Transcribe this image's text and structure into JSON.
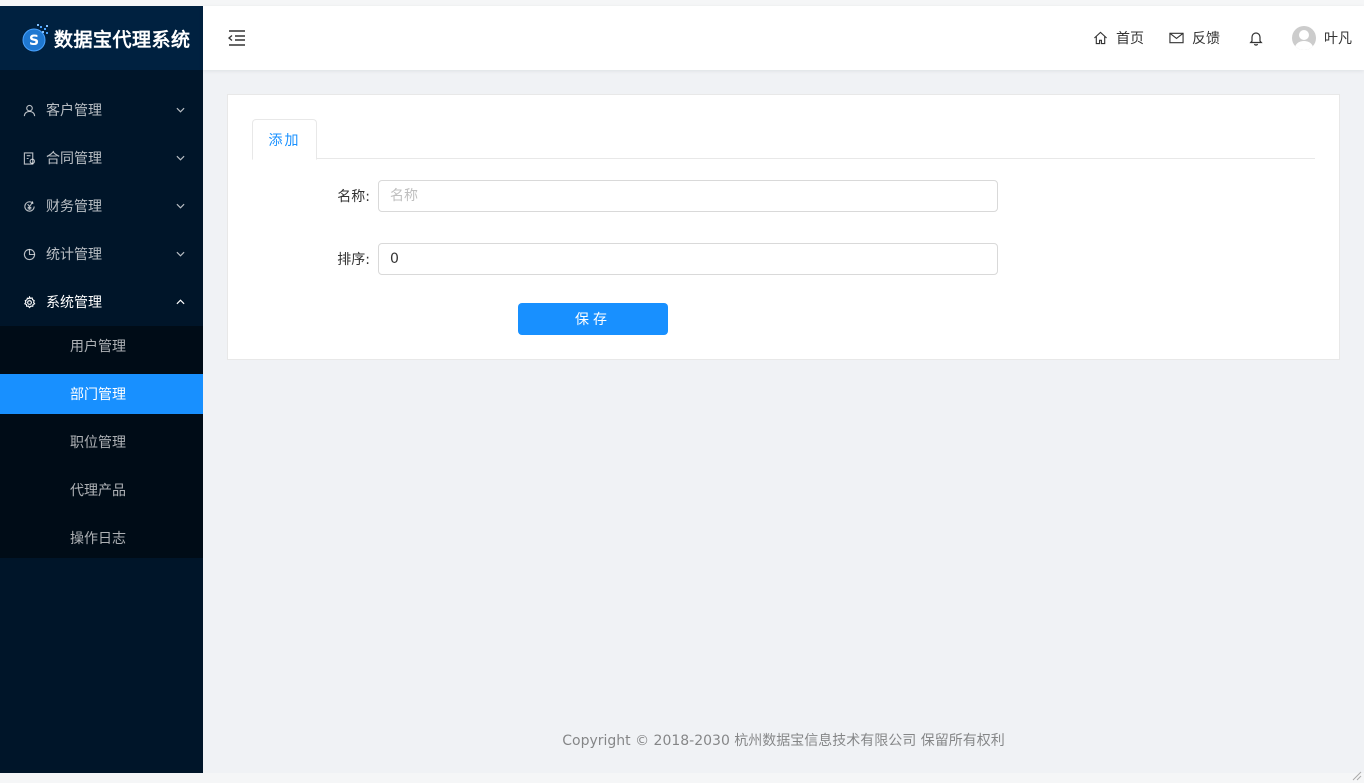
{
  "app": {
    "title": "数据宝代理系统"
  },
  "colors": {
    "sidebar_bg": "#001529",
    "accent": "#1890ff",
    "header_bg": "#ffffff"
  },
  "sidebar": {
    "menus": [
      {
        "label": "客户管理",
        "icon": "user-icon",
        "expanded": false
      },
      {
        "label": "合同管理",
        "icon": "contract-icon",
        "expanded": false
      },
      {
        "label": "财务管理",
        "icon": "finance-icon",
        "expanded": false
      },
      {
        "label": "统计管理",
        "icon": "pie-chart-icon",
        "expanded": false
      },
      {
        "label": "系统管理",
        "icon": "gear-icon",
        "expanded": true
      }
    ],
    "submenu": [
      {
        "label": "用户管理",
        "active": false
      },
      {
        "label": "部门管理",
        "active": true
      },
      {
        "label": "职位管理",
        "active": false
      },
      {
        "label": "代理产品",
        "active": false
      },
      {
        "label": "操作日志",
        "active": false
      }
    ]
  },
  "header": {
    "home_label": "首页",
    "feedback_label": "反馈",
    "user_name": "叶凡"
  },
  "form": {
    "tab_label": "添加",
    "name_label": "名称:",
    "name_placeholder": "名称",
    "name_value": "",
    "order_label": "排序:",
    "order_value": "0",
    "save_label": "保存"
  },
  "footer": {
    "copyright": "Copyright © 2018-2030 杭州数据宝信息技术有限公司 保留所有权利"
  }
}
